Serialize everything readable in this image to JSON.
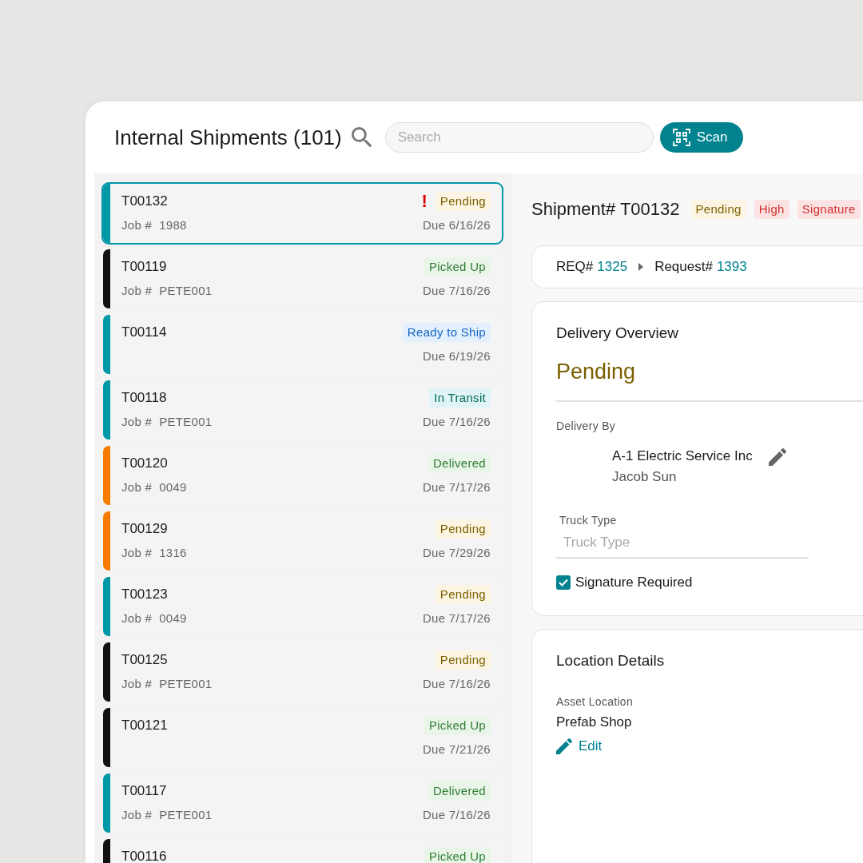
{
  "header": {
    "title": "Internal Shipments (101)",
    "search": {
      "placeholder": "Search"
    },
    "scan_button": "Scan"
  },
  "shipments": [
    {
      "id": "T00132",
      "job_label": "Job #",
      "job": "1988",
      "status": "Pending",
      "kind": "pending",
      "due": "Due 6/16/26",
      "color": "#0097a7",
      "urgent_mark": "!",
      "selected": true
    },
    {
      "id": "T00119",
      "job_label": "Job #",
      "job": "PETE001",
      "status": "Picked Up",
      "kind": "picked",
      "due": "Due 7/16/26",
      "color": "#111111",
      "selected": false
    },
    {
      "id": "T00114",
      "status": "Ready to Ship",
      "kind": "ready",
      "due": "Due 6/19/26",
      "color": "#0097a7",
      "selected": false
    },
    {
      "id": "T00118",
      "job_label": "Job #",
      "job": "PETE001",
      "status": "In Transit",
      "kind": "transit",
      "due": "Due 7/16/26",
      "color": "#0097a7",
      "selected": false
    },
    {
      "id": "T00120",
      "job_label": "Job #",
      "job": "0049",
      "status": "Delivered",
      "kind": "delivered",
      "due": "Due 7/17/26",
      "color": "#f57c00",
      "selected": false
    },
    {
      "id": "T00129",
      "job_label": "Job #",
      "job": "1316",
      "status": "Pending",
      "kind": "pending",
      "due": "Due 7/29/26",
      "color": "#f57c00",
      "selected": false
    },
    {
      "id": "T00123",
      "job_label": "Job #",
      "job": "0049",
      "status": "Pending",
      "kind": "pending",
      "due": "Due 7/17/26",
      "color": "#0097a7",
      "selected": false
    },
    {
      "id": "T00125",
      "job_label": "Job #",
      "job": "PETE001",
      "status": "Pending",
      "kind": "pending",
      "due": "Due 7/16/26",
      "color": "#111111",
      "selected": false
    },
    {
      "id": "T00121",
      "status": "Picked Up",
      "kind": "picked",
      "due": "Due 7/21/26",
      "color": "#111111",
      "selected": false
    },
    {
      "id": "T00117",
      "job_label": "Job #",
      "job": "PETE001",
      "status": "Delivered",
      "kind": "delivered",
      "due": "Due 7/16/26",
      "color": "#0097a7",
      "selected": false
    },
    {
      "id": "T00116",
      "status": "Picked Up",
      "kind": "picked",
      "color": "#111111",
      "selected": false
    }
  ],
  "detail": {
    "title": "Shipment# T00132",
    "tags": [
      {
        "label": "Pending",
        "kind": "pending"
      },
      {
        "label": "High",
        "kind": "alert"
      },
      {
        "label": "Signature",
        "kind": "alert"
      }
    ],
    "breadcrumb": [
      {
        "label": "REQ#",
        "value": "1325"
      },
      {
        "label": "Request#",
        "value": "1393"
      }
    ],
    "delivery": {
      "title": "Delivery Overview",
      "status": "Pending",
      "by_label": "Delivery By",
      "company": "A-1 Electric Service Inc",
      "contact": "Jacob Sun",
      "truck_label": "Truck Type",
      "truck_placeholder": "Truck Type",
      "signature": {
        "label": "Signature Required",
        "checked": true
      }
    },
    "location": {
      "title": "Location Details",
      "asset_label": "Asset Location",
      "asset": "Prefab Shop",
      "edit": "Edit"
    }
  }
}
